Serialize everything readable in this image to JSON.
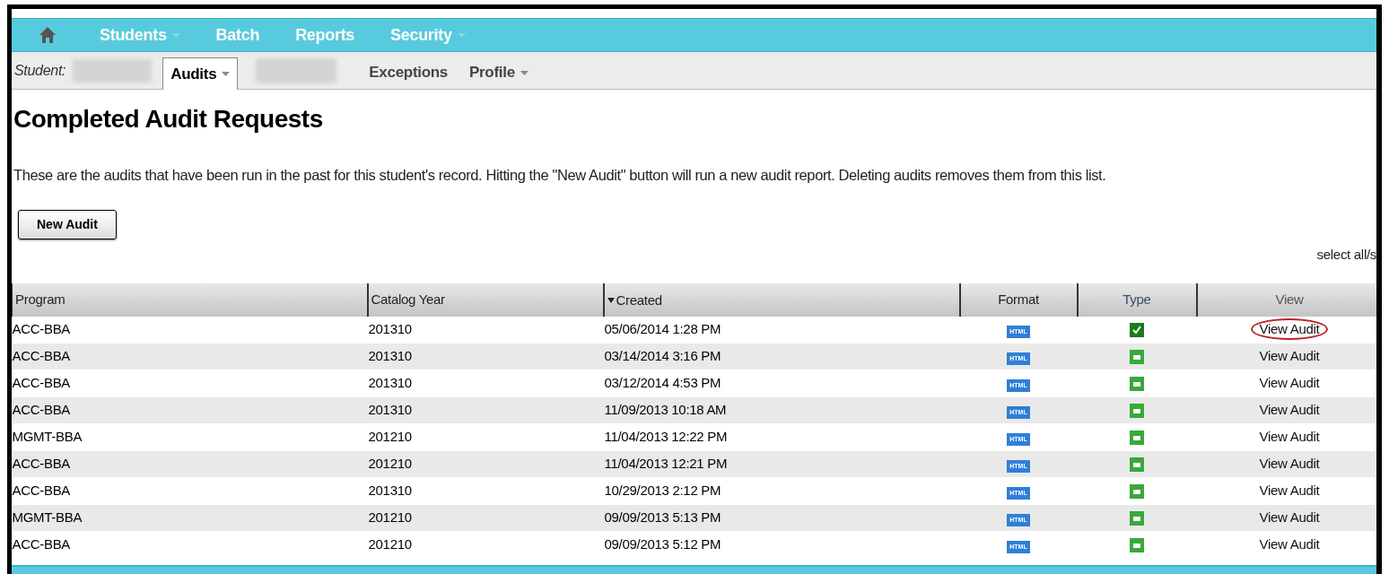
{
  "nav": {
    "items": [
      {
        "kind": "home"
      },
      {
        "kind": "menu",
        "label": "Students",
        "dropdown": true
      },
      {
        "kind": "menu",
        "label": "Batch",
        "dropdown": false
      },
      {
        "kind": "menu",
        "label": "Reports",
        "dropdown": false
      },
      {
        "kind": "menu",
        "label": "Security",
        "dropdown": true
      }
    ]
  },
  "subnav": {
    "student_label": "Student:",
    "tabs": [
      {
        "kind": "redacted"
      },
      {
        "kind": "tab",
        "label": "Audits",
        "dropdown": true,
        "selected": true
      },
      {
        "kind": "redacted"
      },
      {
        "kind": "tab",
        "label": "Exceptions",
        "dropdown": false,
        "selected": false
      },
      {
        "kind": "tab",
        "label": "Profile",
        "dropdown": true,
        "selected": false
      }
    ]
  },
  "page": {
    "title": "Completed Audit Requests",
    "description": "These are the audits that have been run in the past for this student's record. Hitting the \"New Audit\" button will run a new audit report. Deleting audits removes them from this list.",
    "new_audit_button": "New Audit",
    "select_all": "select all/s"
  },
  "table": {
    "columns": [
      {
        "label": "Program",
        "sorted": false
      },
      {
        "label": "Catalog Year",
        "sorted": false
      },
      {
        "label": "Created",
        "sorted": true
      },
      {
        "label": "Format",
        "sorted": false
      },
      {
        "label": "Type",
        "sorted": false
      },
      {
        "label": "View",
        "sorted": false
      }
    ],
    "rows": [
      {
        "program": "ACC-BBA",
        "catalog_year": "201310",
        "created": "05/06/2014 1:28 PM",
        "format": "HTML",
        "kind": "check",
        "view": "View Audit",
        "circled": true
      },
      {
        "program": "ACC-BBA",
        "catalog_year": "201310",
        "created": "03/14/2014 3:16 PM",
        "format": "HTML",
        "kind": "plain",
        "view": "View Audit",
        "circled": false
      },
      {
        "program": "ACC-BBA",
        "catalog_year": "201310",
        "created": "03/12/2014 4:53 PM",
        "format": "HTML",
        "kind": "plain",
        "view": "View Audit",
        "circled": false
      },
      {
        "program": "ACC-BBA",
        "catalog_year": "201310",
        "created": "11/09/2013 10:18 AM",
        "format": "HTML",
        "kind": "plain",
        "view": "View Audit",
        "circled": false
      },
      {
        "program": "MGMT-BBA",
        "catalog_year": "201210",
        "created": "11/04/2013 12:22 PM",
        "format": "HTML",
        "kind": "plain",
        "view": "View Audit",
        "circled": false
      },
      {
        "program": "ACC-BBA",
        "catalog_year": "201210",
        "created": "11/04/2013 12:21 PM",
        "format": "HTML",
        "kind": "plain",
        "view": "View Audit",
        "circled": false
      },
      {
        "program": "ACC-BBA",
        "catalog_year": "201310",
        "created": "10/29/2013 2:12 PM",
        "format": "HTML",
        "kind": "plain",
        "view": "View Audit",
        "circled": false
      },
      {
        "program": "MGMT-BBA",
        "catalog_year": "201210",
        "created": "09/09/2013 5:13 PM",
        "format": "HTML",
        "kind": "plain",
        "view": "View Audit",
        "circled": false
      },
      {
        "program": "ACC-BBA",
        "catalog_year": "201210",
        "created": "09/09/2013 5:12 PM",
        "format": "HTML",
        "kind": "plain",
        "view": "View Audit",
        "circled": false
      }
    ]
  }
}
